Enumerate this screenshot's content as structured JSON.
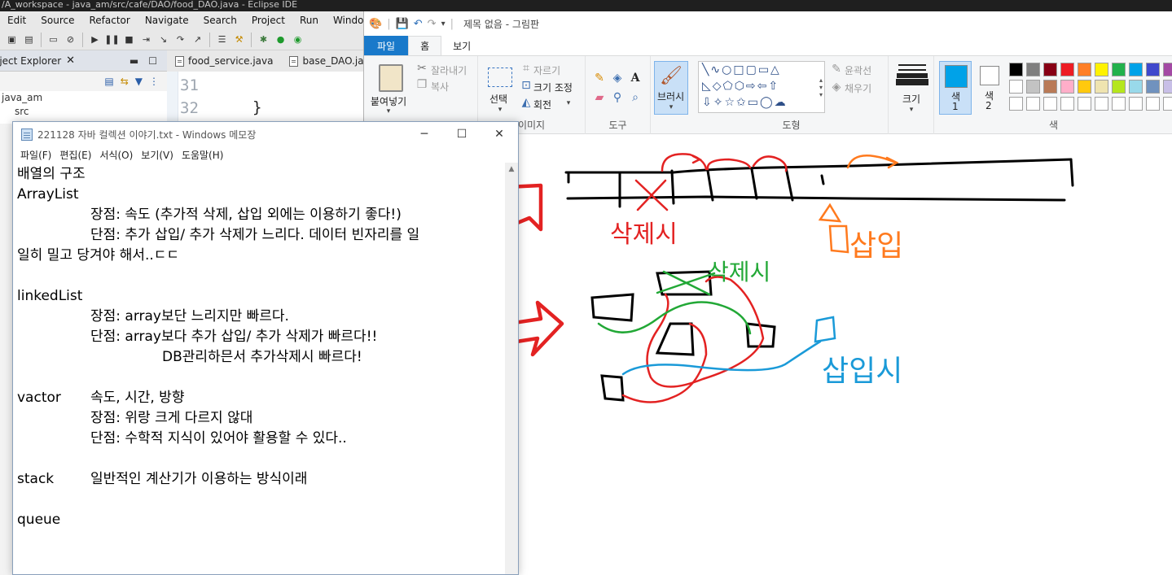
{
  "eclipse": {
    "title": "/A_workspace - java_am/src/cafe/DAO/food_DAO.java - Eclipse IDE",
    "menu": [
      "Edit",
      "Source",
      "Refactor",
      "Navigate",
      "Search",
      "Project",
      "Run",
      "Window"
    ],
    "explorer": {
      "title": "oject Explorer",
      "items": [
        "java_am",
        "src"
      ]
    },
    "editor_tabs": [
      "food_service.java",
      "base_DAO.java"
    ],
    "line_numbers": [
      "31",
      "32"
    ],
    "code_line": "}"
  },
  "notepad": {
    "title": "221128 자바 컬렉션 이야기.txt - Windows 메모장",
    "menu": [
      "파일(F)",
      "편집(E)",
      "서식(O)",
      "보기(V)",
      "도움말(H)"
    ],
    "lines": [
      "배열의 구조",
      "ArrayList",
      "장점: 속도 (추가적 삭제, 삽입 외에는 이용하기 좋다!)",
      "단점: 추가 삽입/ 추가 삭제가 느리다. 데이터 빈자리를 일",
      "일히 밀고 당겨야 해서..ㄷㄷ",
      "linkedList",
      "장점: array보단 느리지만 빠르다.",
      "단점: array보다 추가 삽입/ 추가 삭제가 빠르다!!",
      "DB관리하믄서 추가삭제시 빠르다!",
      "vactor",
      "속도, 시간, 방향",
      "장점: 위랑 크게 다르지 않대",
      "단점: 수학적 지식이 있어야 활용할 수 있다..",
      "stack",
      "일반적인 계산기가 이용하는 방식이래",
      "queue"
    ]
  },
  "paint": {
    "title": "제목 없음 - 그림판",
    "tabs": [
      "파일",
      "홈",
      "보기"
    ],
    "clipboard": {
      "paste": "붙여넣기",
      "cut": "잘라내기",
      "copy": "복사"
    },
    "image": {
      "select": "선택",
      "crop": "자르기",
      "resize": "크기 조정",
      "rotate": "회전",
      "group": "이미지"
    },
    "tools": {
      "group": "도구"
    },
    "brush": {
      "label": "브러시"
    },
    "shapes": {
      "outline": "윤곽선",
      "fill": "채우기",
      "group": "도형"
    },
    "size": {
      "label": "크기"
    },
    "colors": {
      "color1": "색\n1",
      "color1_a": "색",
      "color1_b": "1",
      "color2_a": "색",
      "color2_b": "2",
      "group": "색",
      "palette_row1": [
        "#000000",
        "#7f7f7f",
        "#880015",
        "#ed1c24",
        "#ff7f27",
        "#fff200",
        "#22b14c",
        "#00a2e8",
        "#3f48cc",
        "#a349a4"
      ],
      "palette_row2": [
        "#ffffff",
        "#c3c3c3",
        "#b97a57",
        "#ffaec9",
        "#ffc90e",
        "#efe4b0",
        "#b5e61d",
        "#99d9ea",
        "#7092be",
        "#c8bfe7"
      ],
      "primary": "#00a2e8",
      "secondary": "#ffffff"
    },
    "drawing": {
      "label_delete_red": "삭제시",
      "label_insert_orange": "삽입",
      "label_delete_green": "삭제시",
      "label_insert_blue": "삽입시"
    }
  }
}
